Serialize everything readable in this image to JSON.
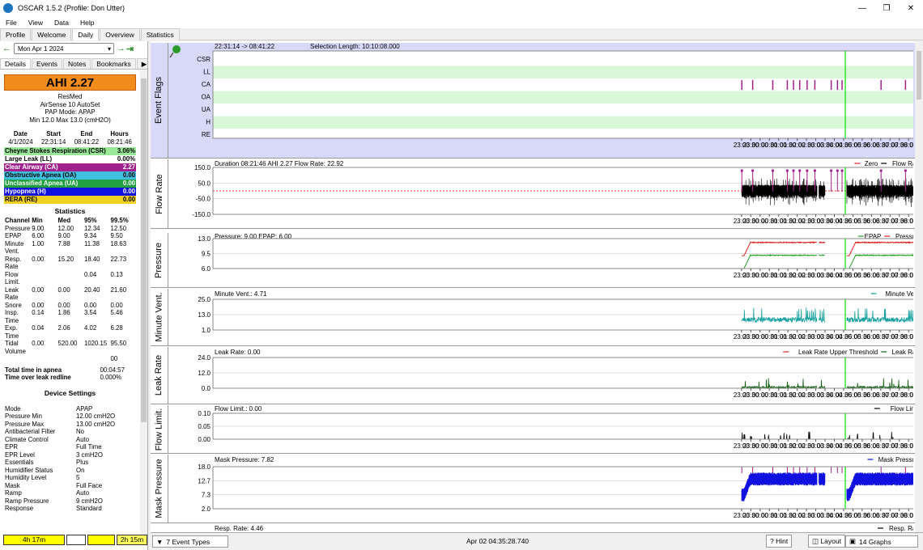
{
  "window": {
    "title": "OSCAR 1.5.2 (Profile: Don Utter)"
  },
  "menu": [
    "File",
    "View",
    "Data",
    "Help"
  ],
  "tabs": [
    "Profile",
    "Welcome",
    "Daily",
    "Overview",
    "Statistics"
  ],
  "date": "Mon Apr 1 2024",
  "subtabs": [
    "Details",
    "Events",
    "Notes",
    "Bookmarks"
  ],
  "ahi": "AHI 2.27",
  "machine": {
    "brand": "ResMed",
    "model": "AirSense 10 AutoSet",
    "mode": "PAP Mode: APAP",
    "range": "Min 12.0 Max 13.0 (cmH2O)"
  },
  "session": {
    "headers": [
      "Date",
      "Start",
      "End",
      "Hours"
    ],
    "values": [
      "4/1/2024",
      "22:31:14",
      "08:41:22",
      "08:21:46"
    ]
  },
  "events": [
    {
      "label": "Cheyne Stokes Respiration (CSR)",
      "value": "3.06%",
      "color": "#98e898",
      "fg": "#000"
    },
    {
      "label": "Large Leak (LL)",
      "value": "0.00%",
      "color": "#ffffff",
      "fg": "#000"
    },
    {
      "label": "Clear Airway (CA)",
      "value": "2.27",
      "color": "#a0208e",
      "fg": "#fff"
    },
    {
      "label": "Obstructive Apnea (OA)",
      "value": "0.00",
      "color": "#40c0e0",
      "fg": "#000"
    },
    {
      "label": "Unclassified Apnea (UA)",
      "value": "0.00",
      "color": "#20a040",
      "fg": "#fff"
    },
    {
      "label": "Hypopnea (H)",
      "value": "0.00",
      "color": "#1010e0",
      "fg": "#fff"
    },
    {
      "label": "RERA (RE)",
      "value": "0.00",
      "color": "#f0d020",
      "fg": "#000"
    }
  ],
  "statistics": {
    "title": "Statistics",
    "headers": [
      "Channel",
      "Min",
      "Med",
      "95%",
      "99.5%"
    ],
    "rows": [
      [
        "Pressure",
        "9.00",
        "12.00",
        "12.34",
        "12.50"
      ],
      [
        "EPAP",
        "6.00",
        "9.00",
        "9.34",
        "9.50"
      ],
      [
        "Minute Vent.",
        "1.00",
        "7.88",
        "11.38",
        "18.63"
      ],
      [
        "Resp. Rate",
        "0.00",
        "15.20",
        "18.40",
        "22.73"
      ],
      [
        "Flow Limit.",
        "",
        "",
        "0.04",
        "0.13"
      ],
      [
        "Leak Rate",
        "0.00",
        "0.00",
        "20.40",
        "21.60"
      ],
      [
        "Snore",
        "0.00",
        "0.00",
        "0.00",
        "0.00"
      ],
      [
        "Insp. Time",
        "0.14",
        "1.86",
        "3.54",
        "5.46"
      ],
      [
        "Exp. Time",
        "0.04",
        "2.06",
        "4.02",
        "6.28"
      ],
      [
        "Tidal Volume",
        "0.00",
        "520.00",
        "1020.15",
        "95.50"
      ]
    ],
    "tidal_extra": "00",
    "apnea_label": "Total time in apnea",
    "apnea_value": "00:04:57",
    "redline_label": "Time over leak redline",
    "redline_value": "0.000%"
  },
  "device": {
    "title": "Device Settings",
    "rows": [
      [
        "Mode",
        "APAP"
      ],
      [
        "Pressure Min",
        "12.00 cmH2O"
      ],
      [
        "Pressure Max",
        "13.00 cmH2O"
      ],
      [
        "Antibacterial Filter",
        "No"
      ],
      [
        "Climate Control",
        "Auto"
      ],
      [
        "EPR",
        "Full Time"
      ],
      [
        "EPR Level",
        "3 cmH2O"
      ],
      [
        "Essentials",
        "Plus"
      ],
      [
        "Humidifier Status",
        "On"
      ],
      [
        "Humidity Level",
        "5"
      ],
      [
        "Mask",
        "Full Face"
      ],
      [
        "Ramp",
        "Auto"
      ],
      [
        "Ramp Pressure",
        "9 cmH2O"
      ],
      [
        "Response",
        "Standard"
      ]
    ]
  },
  "bottom": {
    "left": "4h 17m",
    "right": "2h 15m"
  },
  "xticks": [
    "23:00",
    "23:30",
    "00:00",
    "00:30",
    "01:00",
    "01:30",
    "02:00",
    "02:30",
    "03:00",
    "03:30",
    "04:00",
    "04:30",
    "05:00",
    "05:30",
    "06:00",
    "06:30",
    "07:00",
    "07:30",
    "08:00",
    "08:30"
  ],
  "graphs": {
    "flags": {
      "label": "Event Flags",
      "header": "22:31:14 -> 08:41:22",
      "selection": "Selection Length: 10:10:08.000",
      "rows": [
        "CSR",
        "LL",
        "CA",
        "OA",
        "UA",
        "H",
        "RE"
      ]
    },
    "flow": {
      "label": "Flow Rate",
      "header": "Duration 08:21:46 AHI 2.27 Flow Rate: 22.92",
      "legend": [
        "Zero",
        "Flow Rate"
      ],
      "yticks": [
        "150.0",
        "50.0",
        "-50.0",
        "-150.0"
      ],
      "range": [
        -150,
        150
      ]
    },
    "pressure": {
      "label": "Pressure",
      "header": "Pressure: 9.00 EPAP: 6.00",
      "legend": [
        "EPAP",
        "Pressure"
      ],
      "yticks": [
        "13.0",
        "9.5",
        "6.0"
      ],
      "range": [
        6,
        13
      ]
    },
    "minvent": {
      "label": "Minute Vent.",
      "header": "Minute Vent.: 4.71",
      "legend": [
        "Minute Vent."
      ],
      "yticks": [
        "25.0",
        "13.0",
        "1.0"
      ],
      "range": [
        1,
        25
      ]
    },
    "leak": {
      "label": "Leak Rate",
      "header": "Leak Rate: 0.00",
      "legend": [
        "Leak Rate Upper Threshold",
        "Leak Rate"
      ],
      "yticks": [
        "24.0",
        "12.0",
        "0.0"
      ],
      "range": [
        0,
        24
      ]
    },
    "flowlimit": {
      "label": "Flow Limit.",
      "header": "Flow Limit.: 0.00",
      "legend": [
        "Flow Limit."
      ],
      "yticks": [
        "0.10",
        "0.05",
        "0.00"
      ],
      "range": [
        0,
        0.1
      ]
    },
    "mask": {
      "label": "Mask Pressure",
      "header": "Mask Pressure: 7.82",
      "legend": [
        "Mask Pressure"
      ],
      "yticks": [
        "18.0",
        "12.7",
        "7.3",
        "2.0"
      ],
      "range": [
        2,
        18
      ]
    },
    "resp": {
      "header": "Resp. Rate: 4.46",
      "legend": [
        "Resp. Rate"
      ]
    }
  },
  "status": {
    "eventtypes": "7 Event Types",
    "time": "Apr 02 04:35:28.740",
    "hint": "Hint",
    "layout": "Layout",
    "graphs": "14 Graphs"
  },
  "colors": {
    "accent": "#f28c1c",
    "flow": "#000000",
    "pressure": "#e02020",
    "epap": "#20a020",
    "minvent": "#18a0a0",
    "leak": "#106010",
    "mask": "#1010e0",
    "cursor": "#00e000",
    "csr": "#98e898",
    "ca": "#a0208e"
  }
}
